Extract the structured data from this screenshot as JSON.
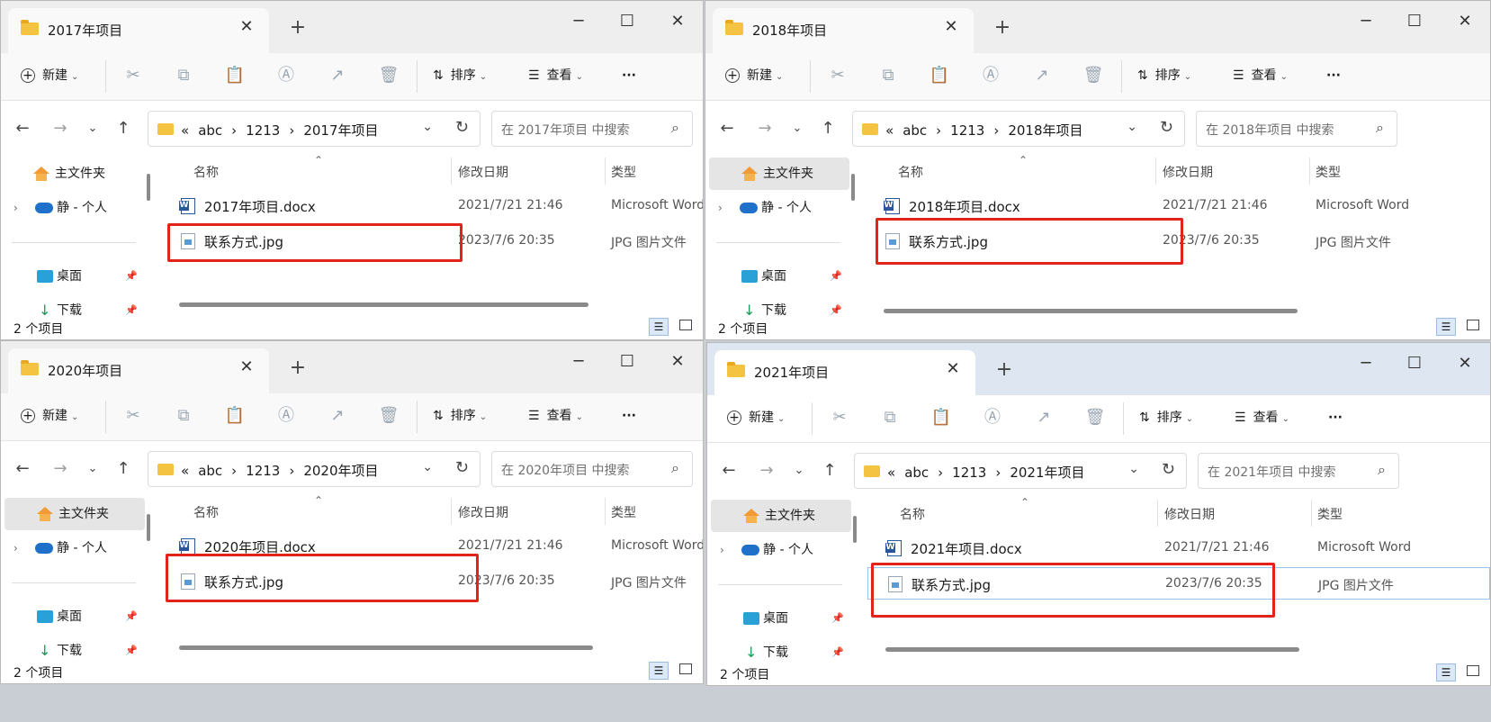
{
  "toolbar": {
    "new_label": "新建",
    "sort_label": "排序",
    "view_label": "查看",
    "more_label": "···"
  },
  "sidebar": {
    "home": "主文件夹",
    "cloud": "静 - 个人",
    "desktop": "桌面",
    "downloads": "下载"
  },
  "columns": {
    "name": "名称",
    "date": "修改日期",
    "type": "类型"
  },
  "path": {
    "overflow": "«",
    "seg1": "abc",
    "seg2": "1213"
  },
  "colors": {
    "highlight_box": "#e2231a",
    "folder": "#f5c342",
    "word_blue": "#2b579a"
  },
  "windows": [
    {
      "title": "2017年项目",
      "search_placeholder": "在 2017年项目 中搜索",
      "status": "2 个项目",
      "files": [
        {
          "name": "2017年项目.docx",
          "date": "2021/7/21 21:46",
          "type": "Microsoft Word"
        },
        {
          "name": "联系方式.jpg",
          "date": "2023/7/6 20:35",
          "type": "JPG 图片文件"
        }
      ]
    },
    {
      "title": "2018年项目",
      "search_placeholder": "在 2018年项目 中搜索",
      "status": "2 个项目",
      "files": [
        {
          "name": "2018年项目.docx",
          "date": "2021/7/21 21:46",
          "type": "Microsoft Word"
        },
        {
          "name": "联系方式.jpg",
          "date": "2023/7/6 20:35",
          "type": "JPG 图片文件"
        }
      ]
    },
    {
      "title": "2020年项目",
      "search_placeholder": "在 2020年项目 中搜索",
      "status": "2 个项目",
      "files": [
        {
          "name": "2020年项目.docx",
          "date": "2021/7/21 21:46",
          "type": "Microsoft Word"
        },
        {
          "name": "联系方式.jpg",
          "date": "2023/7/6 20:35",
          "type": "JPG 图片文件"
        }
      ]
    },
    {
      "title": "2021年项目",
      "search_placeholder": "在 2021年项目 中搜索",
      "status": "2 个项目",
      "files": [
        {
          "name": "2021年项目.docx",
          "date": "2021/7/21 21:46",
          "type": "Microsoft Word"
        },
        {
          "name": "联系方式.jpg",
          "date": "2023/7/6 20:35",
          "type": "JPG 图片文件"
        }
      ]
    }
  ]
}
